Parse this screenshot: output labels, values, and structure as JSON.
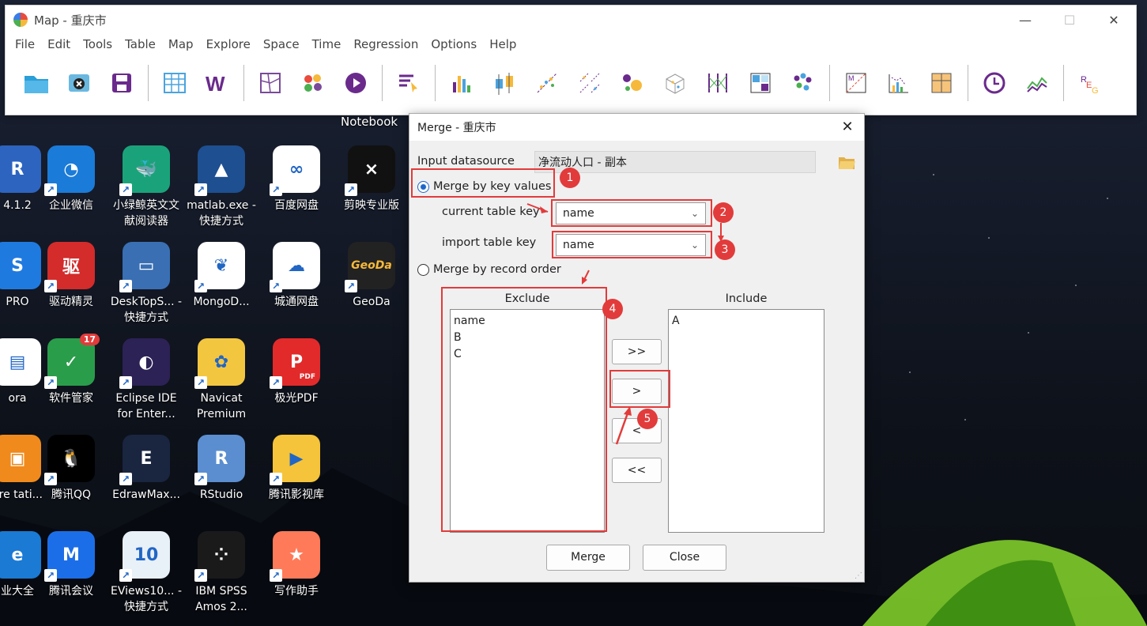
{
  "window": {
    "title": "Map - 重庆市",
    "menu": [
      "File",
      "Edit",
      "Tools",
      "Table",
      "Map",
      "Explore",
      "Space",
      "Time",
      "Regression",
      "Options",
      "Help"
    ],
    "controls": {
      "minimize": "—",
      "maximize": "☐",
      "close": "✕"
    },
    "toolbar_icons": [
      "open-folder-icon",
      "close-datasource-icon",
      "save-icon",
      "table-icon",
      "weights-icon",
      "map-icon",
      "cluster-icon",
      "animation-icon",
      "select-icon",
      "histogram-icon",
      "boxplot-icon",
      "scatter-plot-icon",
      "scatter-matrix-icon",
      "bubble-chart-icon",
      "3d-scatter-icon",
      "parallel-coordinate-icon",
      "conditional-plot-icon",
      "cluster-map-icon",
      "moran-scatter-icon",
      "lisa-icon",
      "cartogram-icon",
      "time-icon",
      "averages-chart-icon",
      "regression-icon"
    ]
  },
  "desktop": {
    "notebook_label": "Notebook",
    "icons": [
      {
        "label": "4.1.2"
      },
      {
        "label": "企业微信"
      },
      {
        "label": "小绿鲸英文文献阅读器"
      },
      {
        "label": "matlab.exe - 快捷方式"
      },
      {
        "label": "百度网盘"
      },
      {
        "label": "剪映专业版"
      },
      {
        "label": "PRO"
      },
      {
        "label": "驱动精灵"
      },
      {
        "label": "DeskTopS... - 快捷方式"
      },
      {
        "label": "MongoD..."
      },
      {
        "label": "城通网盘"
      },
      {
        "label": "GeoDa"
      },
      {
        "label": "ora"
      },
      {
        "label": "软件管家"
      },
      {
        "label": "Eclipse IDE for Enter..."
      },
      {
        "label": "Navicat Premium"
      },
      {
        "label": "极光PDF"
      },
      {
        "label": "are tati..."
      },
      {
        "label": "腾讯QQ"
      },
      {
        "label": "EdrawMax..."
      },
      {
        "label": "RStudio"
      },
      {
        "label": "腾讯影视库"
      },
      {
        "label": "业大全"
      },
      {
        "label": "腾讯会议"
      },
      {
        "label": "EViews10... - 快捷方式"
      },
      {
        "label": "IBM SPSS Amos 2..."
      },
      {
        "label": "写作助手"
      }
    ],
    "badge_count": "17",
    "icon_texts": {
      "driver": "驱",
      "geoda": "GeoDa",
      "eviews": "10",
      "pdf": "PDF"
    }
  },
  "dialog": {
    "title": "Merge - 重庆市",
    "close": "✕",
    "input_datasource_label": "Input datasource",
    "input_datasource_value": "净流动人口 - 副本",
    "merge_by_key_label": "Merge by key values",
    "merge_by_key_selected": true,
    "current_table_key_label": "current table key",
    "current_table_key_value": "name",
    "import_table_key_label": "import table key",
    "import_table_key_value": "name",
    "merge_by_record_label": "Merge by record order",
    "exclude_label": "Exclude",
    "include_label": "Include",
    "exclude_items": [
      "name",
      "B",
      "C"
    ],
    "include_items": [
      "A"
    ],
    "buttons": {
      "move_all_right": ">>",
      "move_right": ">",
      "move_left": "<",
      "move_all_left": "<<",
      "merge": "Merge",
      "close": "Close"
    }
  },
  "annotations": [
    "1",
    "2",
    "3",
    "4",
    "5"
  ],
  "colors": {
    "annotation": "#e23b3b",
    "radio_selected": "#1c66c9"
  }
}
